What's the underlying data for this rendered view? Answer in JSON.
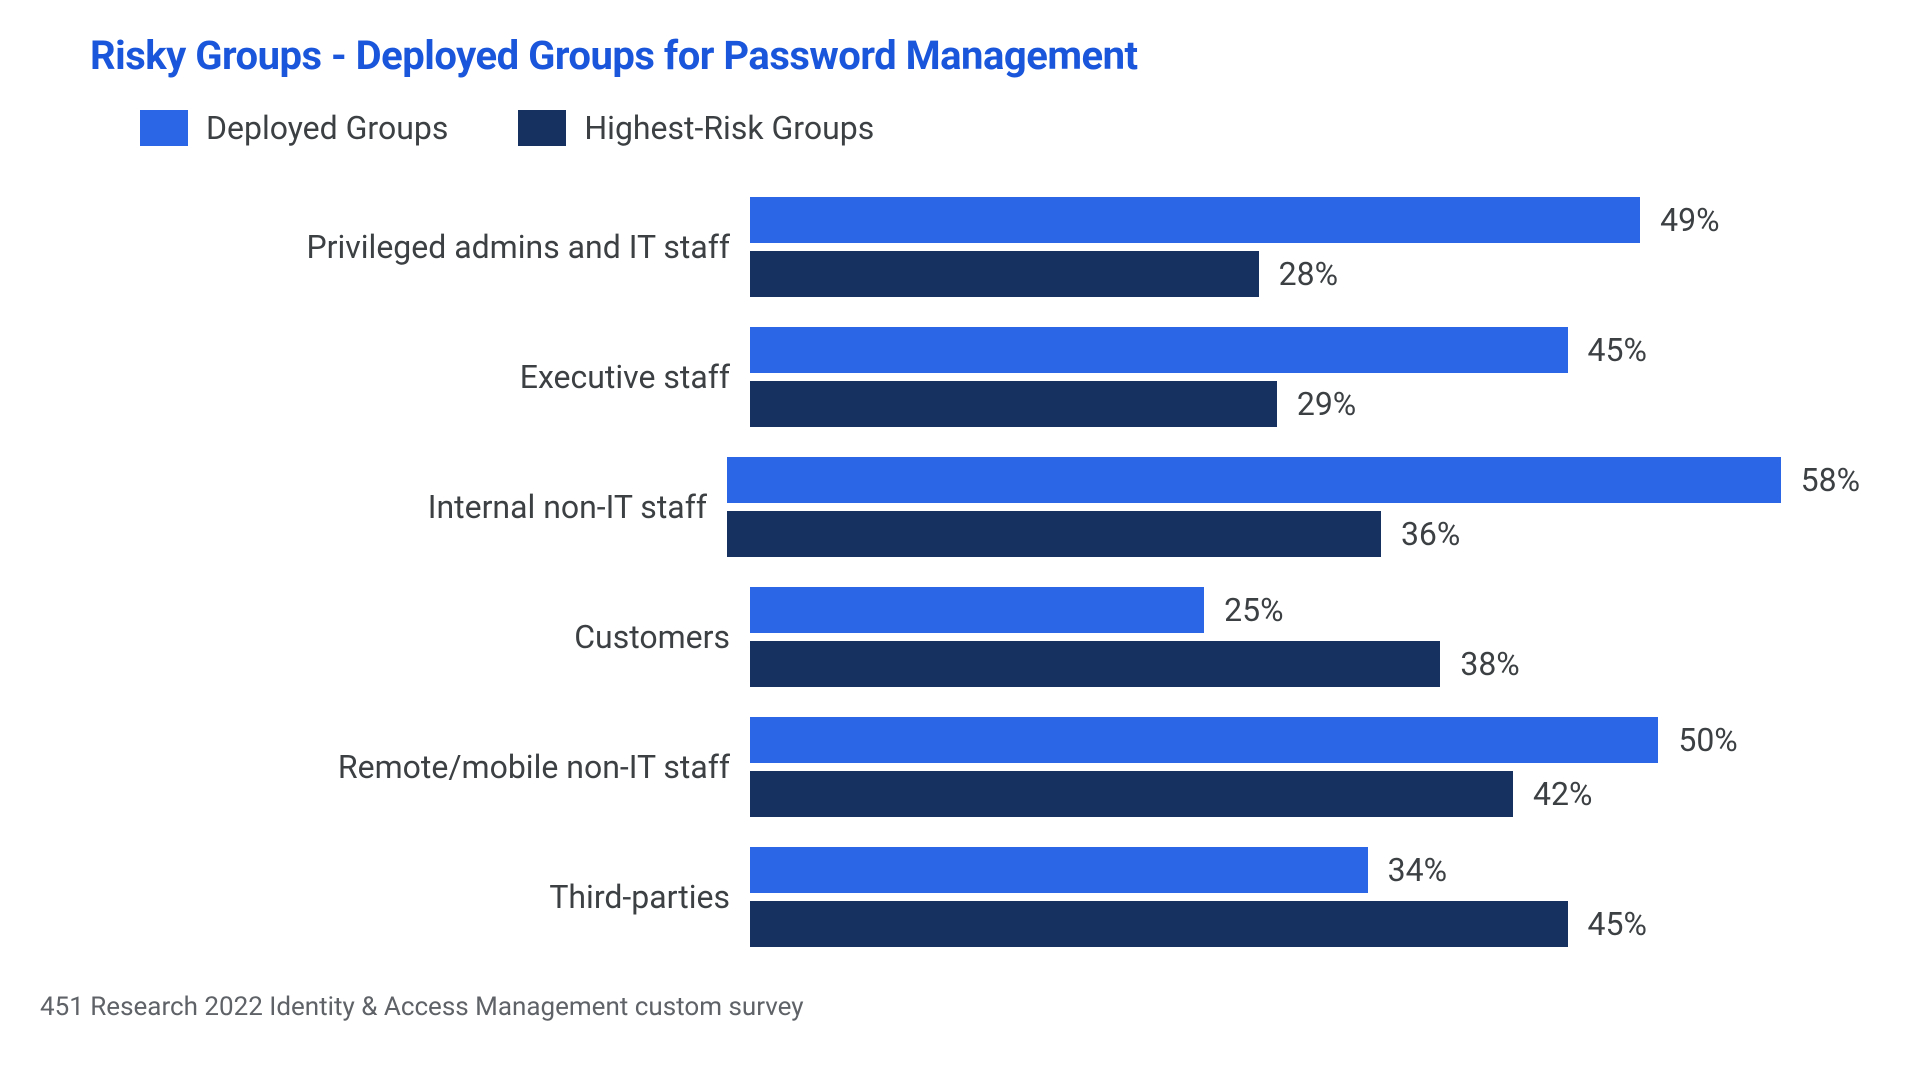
{
  "chart_data": {
    "type": "bar",
    "orientation": "horizontal",
    "title": "Risky Groups - Deployed Groups for Password Management",
    "categories": [
      "Privileged admins and IT staff",
      "Executive staff",
      "Internal non-IT staff",
      "Customers",
      "Remote/mobile non-IT staff",
      "Third-parties"
    ],
    "series": [
      {
        "name": "Deployed Groups",
        "color": "#2a66e6",
        "values": [
          49,
          45,
          58,
          25,
          50,
          34
        ]
      },
      {
        "name": "Highest-Risk Groups",
        "color": "#16315f",
        "values": [
          28,
          29,
          36,
          38,
          42,
          45
        ]
      }
    ],
    "xlim": [
      0,
      60
    ],
    "value_suffix": "%",
    "legend_position": "top-left",
    "footnote": "451 Research 2022 Identity & Access Management custom survey"
  }
}
